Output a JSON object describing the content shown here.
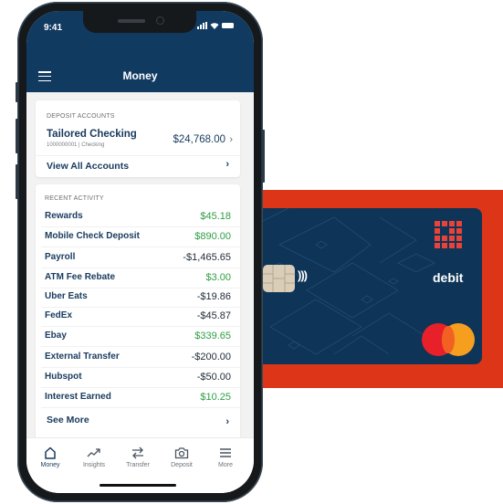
{
  "status_bar": {
    "time": "9:41"
  },
  "header": {
    "title": "Money"
  },
  "deposit_accounts": {
    "section_label": "DEPOSIT ACCOUNTS",
    "account": {
      "name": "Tailored Checking",
      "meta": "1000000001 | Checking",
      "balance": "$24,768.00"
    },
    "view_all_label": "View All Accounts"
  },
  "recent_activity": {
    "section_label": "RECENT ACTIVITY",
    "items": [
      {
        "name": "Rewards",
        "amount": "$45.18",
        "type": "credit"
      },
      {
        "name": "Mobile Check Deposit",
        "amount": "$890.00",
        "type": "credit"
      },
      {
        "name": "Payroll",
        "amount": "-$1,465.65",
        "type": "debit"
      },
      {
        "name": "ATM Fee Rebate",
        "amount": "$3.00",
        "type": "credit"
      },
      {
        "name": "Uber Eats",
        "amount": "-$19.86",
        "type": "debit"
      },
      {
        "name": "FedEx",
        "amount": "-$45.87",
        "type": "debit"
      },
      {
        "name": "Ebay",
        "amount": "$339.65",
        "type": "credit"
      },
      {
        "name": "External Transfer",
        "amount": "-$200.00",
        "type": "debit"
      },
      {
        "name": "Hubspot",
        "amount": "-$50.00",
        "type": "debit"
      },
      {
        "name": "Interest Earned",
        "amount": "$10.25",
        "type": "credit"
      }
    ],
    "see_more_label": "See More"
  },
  "tabbar": {
    "tabs": [
      {
        "label": "Money",
        "icon": "home-icon",
        "active": true
      },
      {
        "label": "Insights",
        "icon": "trending-up-icon",
        "active": false
      },
      {
        "label": "Transfer",
        "icon": "transfer-arrows-icon",
        "active": false
      },
      {
        "label": "Deposit",
        "icon": "camera-icon",
        "active": false
      },
      {
        "label": "More",
        "icon": "menu-icon",
        "active": false
      }
    ]
  },
  "card": {
    "type_label": "debit",
    "network": "mastercard",
    "contactless_symbol": ")))"
  },
  "colors": {
    "primary": "#113a61",
    "credit": "#2f9e44",
    "debit": "#1f2a36",
    "card_bg": "#0e3457",
    "accent_red": "#dc3517",
    "mc_red": "#e8202a",
    "mc_yellow": "#f69e1e"
  }
}
